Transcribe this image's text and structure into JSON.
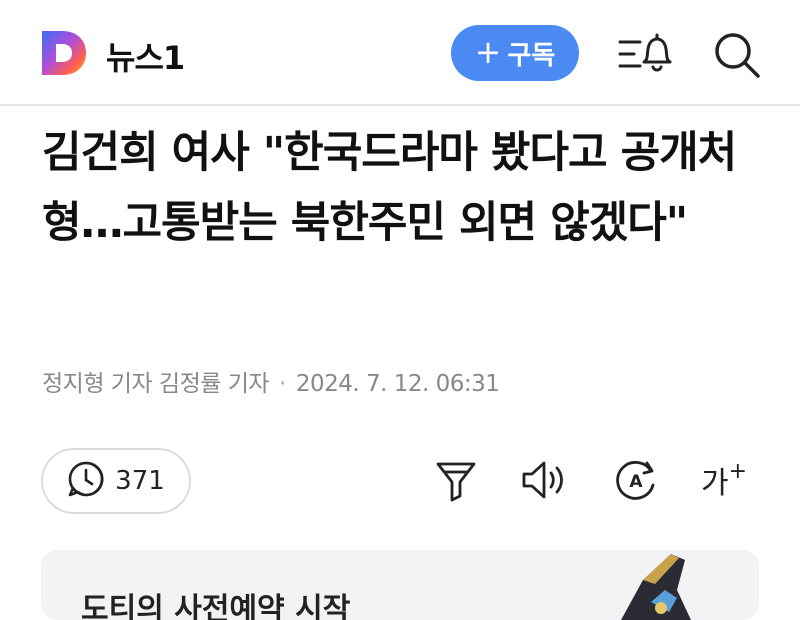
{
  "header": {
    "logo_letter": "D",
    "brand": "뉴스1",
    "subscribe_plus": "+",
    "subscribe_label": "구독",
    "notification_icon": "notification-bell-icon",
    "search_icon": "search-icon"
  },
  "article": {
    "title": "김건희 여사 \"한국드라마 봤다고 공개처형…고통받는 북한주민 외면 않겠다\"",
    "reporters": "정지형 기자 김정률 기자",
    "separator": "·",
    "date": "2024. 7. 12. 06:31"
  },
  "toolbar": {
    "comment_count": "371",
    "summary_icon": "summary-filter-icon",
    "audio_icon": "speaker-icon",
    "translate_icon": "translate-icon",
    "font_size_label": "가",
    "font_size_plus": "+"
  },
  "banner": {
    "text": "도티의 사전예약 시작"
  },
  "colors": {
    "accent": "#4b8af2",
    "text": "#111111",
    "muted": "#888888"
  }
}
